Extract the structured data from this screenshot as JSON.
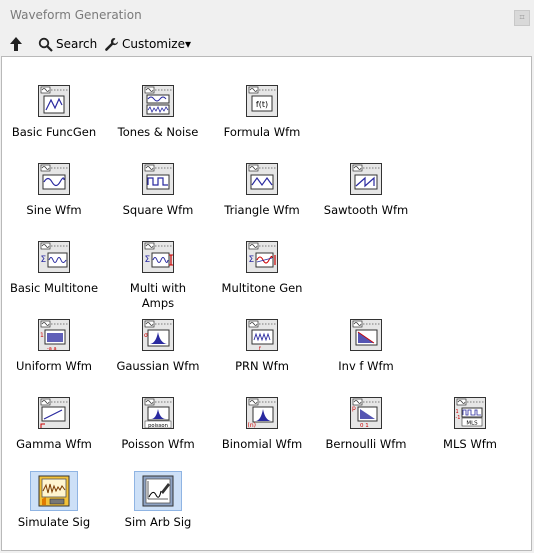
{
  "window": {
    "title": "Waveform Generation"
  },
  "toolbar": {
    "up_label": "",
    "search_label": "Search",
    "customize_label": "Customize▾"
  },
  "items": [
    {
      "label": "Basic FuncGen",
      "icon": "basic-funcgen-icon"
    },
    {
      "label": "Tones & Noise",
      "icon": "tones-noise-icon"
    },
    {
      "label": "Formula Wfm",
      "icon": "formula-wfm-icon",
      "glyph": "f(t)"
    },
    {
      "label": "Sine Wfm",
      "icon": "sine-wfm-icon"
    },
    {
      "label": "Square Wfm",
      "icon": "square-wfm-icon"
    },
    {
      "label": "Triangle Wfm",
      "icon": "triangle-wfm-icon"
    },
    {
      "label": "Sawtooth Wfm",
      "icon": "sawtooth-wfm-icon"
    },
    {
      "label": "Basic Multitone",
      "icon": "basic-multitone-icon"
    },
    {
      "label": "Multi with\nAmps",
      "icon": "multi-with-amps-icon"
    },
    {
      "label": "Multitone Gen",
      "icon": "multitone-gen-icon"
    },
    {
      "label": "Uniform Wfm",
      "icon": "uniform-wfm-icon"
    },
    {
      "label": "Gaussian Wfm",
      "icon": "gaussian-wfm-icon"
    },
    {
      "label": "PRN Wfm",
      "icon": "prn-wfm-icon"
    },
    {
      "label": "Inv f Wfm",
      "icon": "inv-f-wfm-icon"
    },
    {
      "label": "Gamma Wfm",
      "icon": "gamma-wfm-icon"
    },
    {
      "label": "Poisson Wfm",
      "icon": "poisson-wfm-icon",
      "glyph": "poisson"
    },
    {
      "label": "Binomial Wfm",
      "icon": "binomial-wfm-icon",
      "glyph": "(n)"
    },
    {
      "label": "Bernoulli Wfm",
      "icon": "bernoulli-wfm-icon",
      "glyph": "0 1"
    },
    {
      "label": "MLS Wfm",
      "icon": "mls-wfm-icon",
      "glyph": "MLS"
    },
    {
      "label": "Simulate Sig",
      "icon": "simulate-sig-icon"
    },
    {
      "label": "Sim Arb Sig",
      "icon": "sim-arb-sig-icon"
    }
  ]
}
